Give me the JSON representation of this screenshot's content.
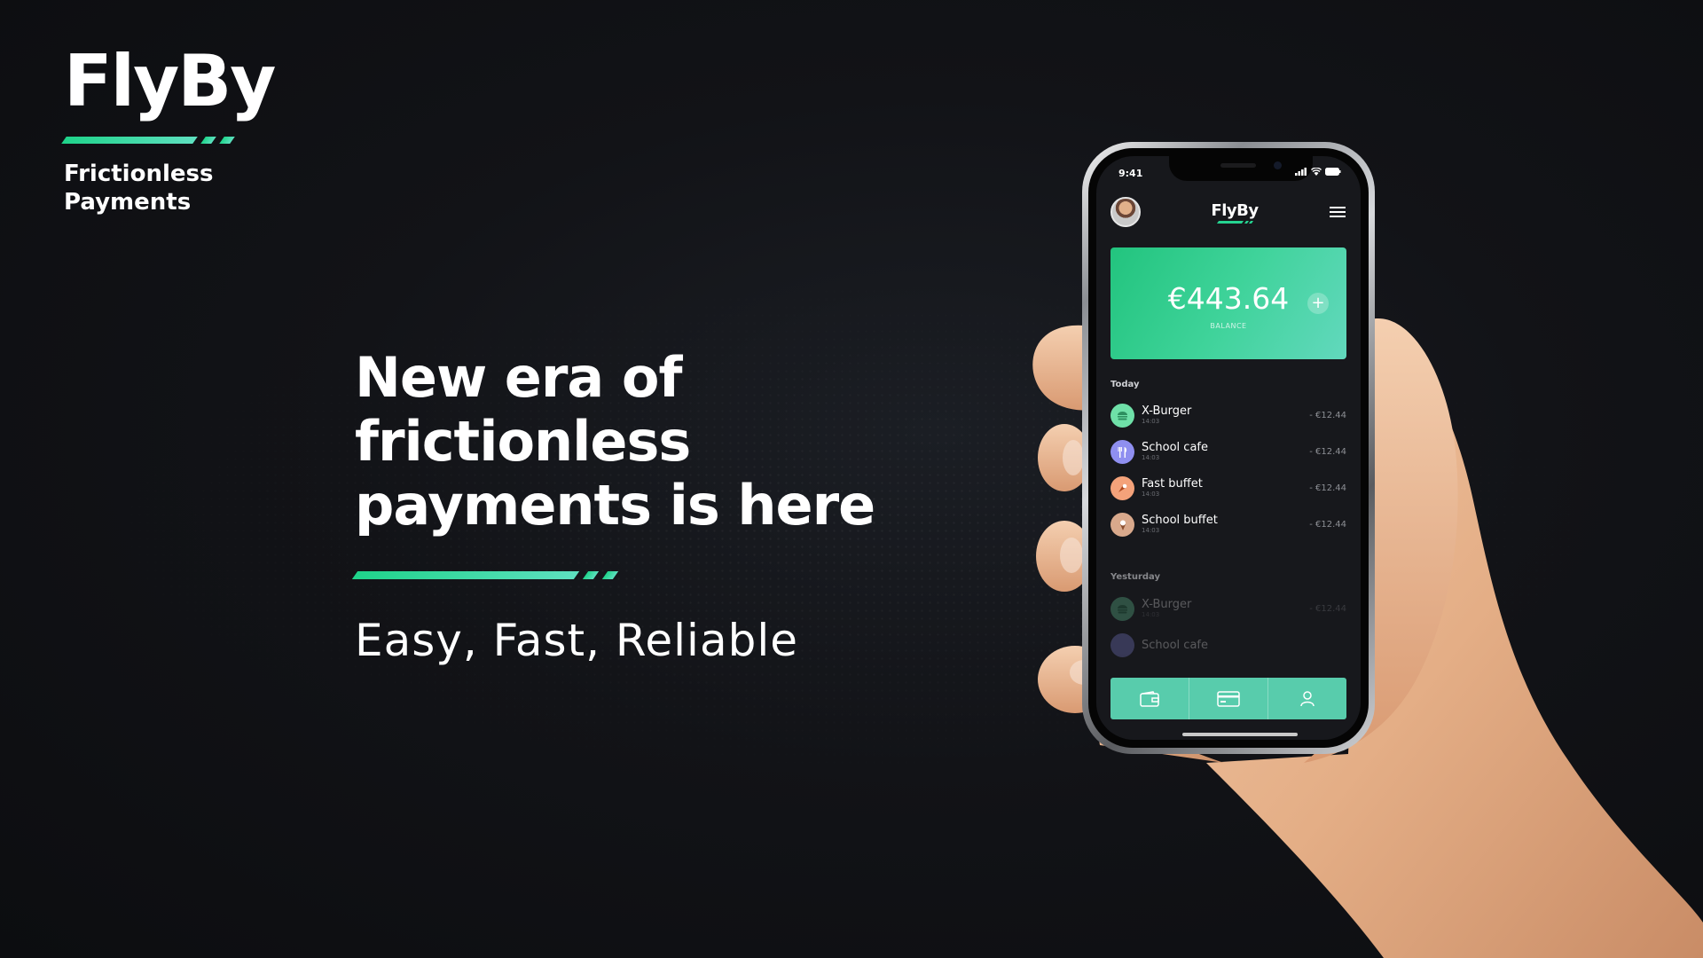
{
  "brand": {
    "logo": "FlyBy",
    "tagline": "Frictionless Payments",
    "accent_color": "#1fd38a"
  },
  "hero": {
    "headline": "New era of frictionless payments is here",
    "subline": "Easy, Fast, Reliable"
  },
  "phone": {
    "status_time": "9:41",
    "app_title": "FlyBy",
    "balance": {
      "amount": "€443.64",
      "label": "BALANCE"
    },
    "today_label": "Today",
    "yesterday_label": "Yesturday",
    "today_transactions": [
      {
        "name": "X-Burger",
        "time": "14:03",
        "amount": "- €12.44",
        "icon": "burger-icon",
        "icon_color": "#6fe0a8"
      },
      {
        "name": "School cafe",
        "time": "14:03",
        "amount": "- €12.44",
        "icon": "cutlery-icon",
        "icon_color": "#8f8ff0"
      },
      {
        "name": "Fast buffet",
        "time": "14:03",
        "amount": "- €12.44",
        "icon": "food-icon",
        "icon_color": "#f4a27a"
      },
      {
        "name": "School buffet",
        "time": "14:03",
        "amount": "- €12.44",
        "icon": "ice-cream-icon",
        "icon_color": "#d9a98c"
      }
    ],
    "yesterday_transactions": [
      {
        "name": "X-Burger",
        "time": "14:03",
        "amount": "- €12.44",
        "icon": "burger-icon",
        "icon_color": "#6fe0a8"
      },
      {
        "name": "School cafe",
        "time": "",
        "amount": "",
        "icon": "cutlery-icon",
        "icon_color": "#8f8ff0"
      }
    ],
    "tabs": [
      {
        "icon": "wallet-icon"
      },
      {
        "icon": "card-icon"
      },
      {
        "icon": "profile-icon"
      }
    ],
    "tab_bar_color": "#58ccac"
  }
}
